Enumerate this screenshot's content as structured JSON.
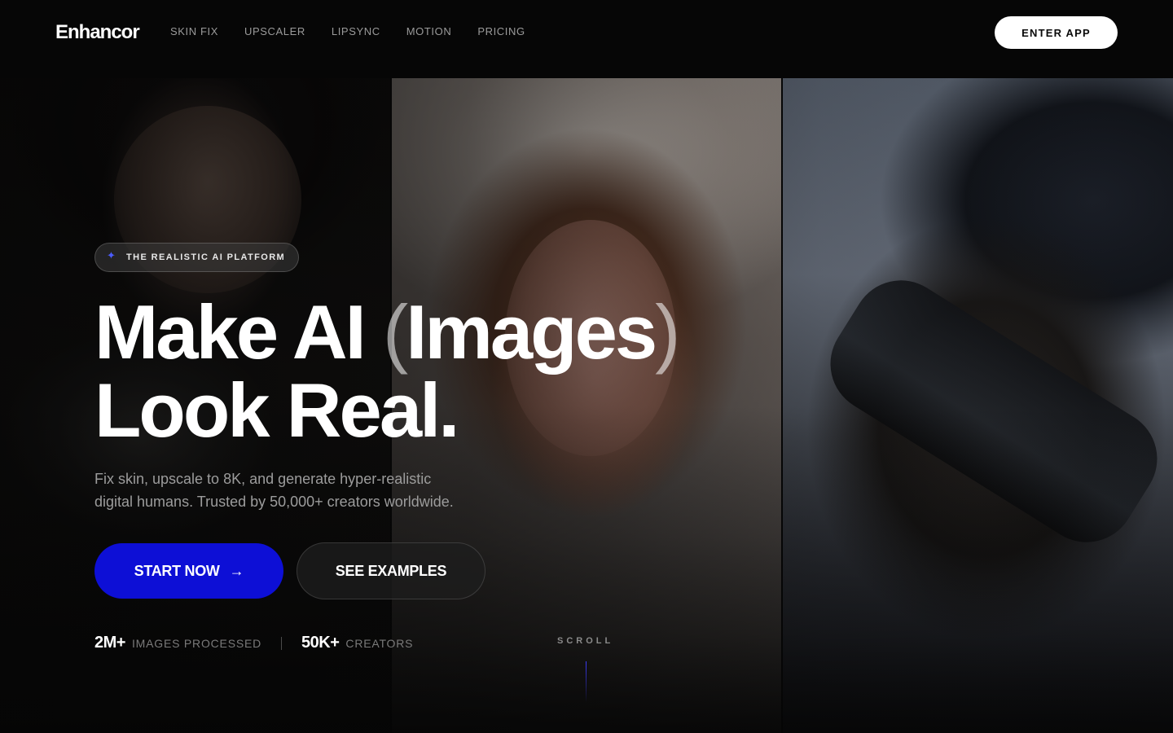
{
  "nav": {
    "logo": "Enhancor",
    "links": [
      "SKIN FIX",
      "UPSCALER",
      "LIPSYNC",
      "MOTION",
      "PRICING"
    ],
    "cta": "ENTER APP"
  },
  "hero": {
    "badge": "THE REALISTIC AI PLATFORM",
    "badge_icon": "sparkle-icon",
    "headline_line1_a": "Make AI ",
    "headline_paren_open": "(",
    "headline_line1_b": "Images",
    "headline_paren_close": ")",
    "headline_line2": "Look Real.",
    "subtitle": "Fix skin, upscale to 8K, and generate hyper-realistic digital humans. Trusted by 50,000+ creators worldwide.",
    "primary_button": "START NOW",
    "primary_button_icon": "arrow-right-icon",
    "secondary_button": "SEE EXAMPLES",
    "stats": [
      {
        "value": "2M+",
        "label": "IMAGES PROCESSED"
      },
      {
        "value": "50K+",
        "label": "CREATORS"
      }
    ],
    "scroll_label": "SCROLL"
  },
  "colors": {
    "background": "#050505",
    "primary": "#0d0fd6",
    "accent": "#4b5cff",
    "text": "#ffffff",
    "muted": "#9c9c9c"
  }
}
